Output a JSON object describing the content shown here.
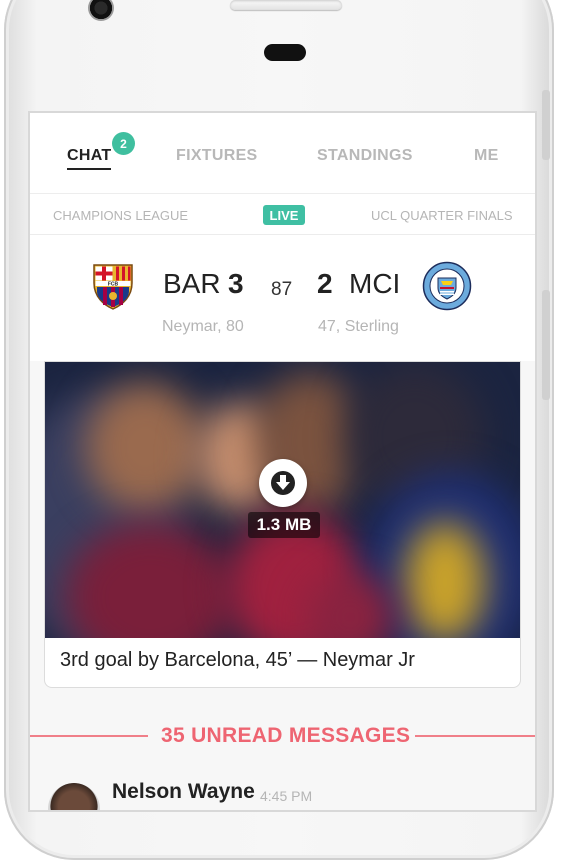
{
  "tabs": [
    {
      "label": "CHAT",
      "active": true,
      "badge": "2"
    },
    {
      "label": "FIXTURES",
      "active": false
    },
    {
      "label": "STANDINGS",
      "active": false
    },
    {
      "label": "ME",
      "active": false
    }
  ],
  "league": {
    "competition": "CHAMPIONS LEAGUE",
    "status": "LIVE",
    "round": "UCL QUARTER FINALS"
  },
  "match": {
    "home": {
      "abbr": "BAR",
      "goals": "3",
      "scorer": "Neymar, 80",
      "crest": "fc-barcelona-crest-icon"
    },
    "away": {
      "abbr": "MCI",
      "goals": "2",
      "scorer": "47, Sterling",
      "crest": "manchester-city-crest-icon"
    },
    "minute": "87"
  },
  "media": {
    "size": "1.3 MB",
    "caption": "3rd goal by Barcelona, 45’ — Neymar Jr",
    "download_icon": "download-arrow-icon"
  },
  "unread": {
    "label": "35 UNREAD MESSAGES"
  },
  "message": {
    "name": "Nelson Wayne",
    "time": "4:45 PM"
  },
  "colors": {
    "accent": "#3fbf9f",
    "unread": "#ee6572"
  }
}
